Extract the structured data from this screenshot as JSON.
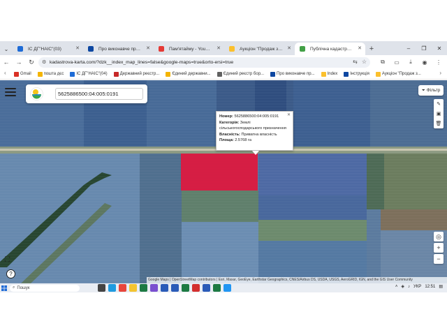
{
  "browser": {
    "tabs": [
      {
        "title": "ІС ДГ\"НАІС\"(03)",
        "color": "#1e6bd6"
      },
      {
        "title": "Про виконавче провадження",
        "color": "#0d47a1"
      },
      {
        "title": "Пам'ятайму - YouTube",
        "color": "#e53935"
      },
      {
        "title": "Аукціон \"Продаж земельн",
        "color": "#fbc02d"
      },
      {
        "title": "Публічна кадастрова карта",
        "color": "#43a047",
        "active": true
      }
    ],
    "new_tab": "+",
    "url": "kadastrova-karta.com/?dzk__index_map_lines=false&google-maps=true&orto-ersi=true",
    "bookmarks": [
      {
        "label": "Gmail",
        "color": "#d93025"
      },
      {
        "label": "пошта дєс",
        "color": "#f4b400"
      },
      {
        "label": "ІС ДГ\"НАІС\"(04)",
        "color": "#1e6bd6"
      },
      {
        "label": "Державний реєстр...",
        "color": "#c62828"
      },
      {
        "label": "Єдиний державни...",
        "color": "#f4b400"
      },
      {
        "label": "Єдиний реєстр бор...",
        "color": "#616161"
      },
      {
        "label": "Про виконавче пр...",
        "color": "#0d47a1"
      },
      {
        "label": "Index",
        "color": "#fbc02d"
      },
      {
        "label": "Інструкція",
        "color": "#0d47a1"
      },
      {
        "label": "Аукціон \"Продаж з...",
        "color": "#fbc02d"
      }
    ]
  },
  "map": {
    "search_value": "5625886500:04:005:0191",
    "filter_label": "Фільтр",
    "popup": {
      "number_label": "Номер:",
      "number": "5625886500:04:005:0191",
      "category_label": "Категорія:",
      "category": "Землі сільськогосподарського призначення",
      "ownership_label": "Власність:",
      "ownership": "Приватна власність",
      "area_label": "Площа:",
      "area": "2.5768 га"
    },
    "attribution": "Google Maps | OpenStreetMap contributors | Esri, Maxar, GeoEye, Earthstar Geographics, CNES/Airbus DS, USDA, USGS, AeroGRID, IGN, and the GIS User Community",
    "parcel_color": "#e0163d"
  },
  "taskbar": {
    "search_placeholder": "Пошук",
    "language": "УКР",
    "time": "12:51"
  }
}
